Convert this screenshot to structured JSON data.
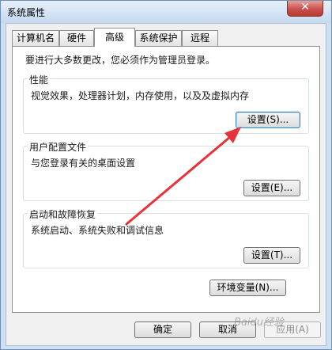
{
  "window": {
    "title": "系统属性",
    "close_label": "✕"
  },
  "tabs": [
    {
      "label": "计算机名",
      "active": false
    },
    {
      "label": "硬件",
      "active": false
    },
    {
      "label": "高级",
      "active": true
    },
    {
      "label": "系统保护",
      "active": false
    },
    {
      "label": "远程",
      "active": false
    }
  ],
  "notice": "要进行大多数更改，您必须作为管理员登录。",
  "groups": {
    "performance": {
      "title": "性能",
      "description": "视觉效果，处理器计划，内存使用，以及及虚拟内存",
      "button": "设置(S)..."
    },
    "user_profiles": {
      "title": "用户配置文件",
      "description": "与您登录有关的桌面设置",
      "button": "设置(E)..."
    },
    "startup_recovery": {
      "title": "启动和故障恢复",
      "description": "系统启动、系统失败和调试信息",
      "button": "设置(T)..."
    }
  },
  "env_button": "环境变量(N)...",
  "footer": {
    "ok": "确定",
    "cancel": "取消",
    "apply": "应用(A)"
  },
  "watermark": "Baidu经验",
  "colors": {
    "arrow": "#e8323a",
    "close_button": "#c75050",
    "focus_border": "#3c7fb1"
  }
}
